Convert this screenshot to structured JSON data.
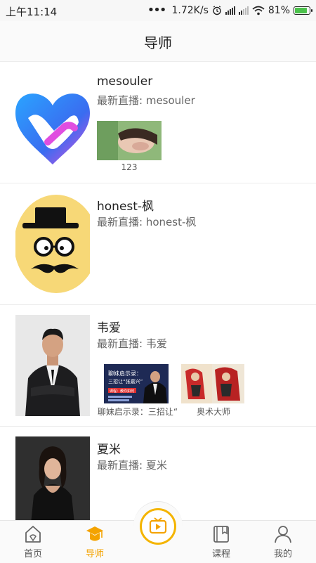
{
  "status_bar": {
    "time": "上午11:14",
    "network_speed": "1.72K/s",
    "battery": "81%"
  },
  "header": {
    "title": "导师"
  },
  "mentors": [
    {
      "name": "mesouler",
      "latest_label": "最新直播",
      "latest_value": "mesouler",
      "lives": [
        {
          "title": "123"
        }
      ]
    },
    {
      "name": "honest-枫",
      "latest_label": "最新直播",
      "latest_value": "honest-枫",
      "lives": []
    },
    {
      "name": "韦爱",
      "latest_label": "最新直播",
      "latest_value": "韦爱",
      "lives": [
        {
          "title": "聊妹启示录：三招让“"
        },
        {
          "title": "奥术大师"
        }
      ]
    },
    {
      "name": "夏米",
      "latest_label": "最新直播",
      "latest_value": "夏米",
      "lives": []
    }
  ],
  "thumbnail_text": {
    "poster_1_title": "聊妹启示录：",
    "poster_1_sub": "三招让“张嘉兴”",
    "poster_1_tag": "课程：教你如何"
  },
  "tabs": [
    {
      "label": "首页",
      "icon": "home-icon"
    },
    {
      "label": "导师",
      "icon": "graduation-cap-icon",
      "active": true
    },
    {
      "label": "",
      "icon": "live-tv-icon"
    },
    {
      "label": "课程",
      "icon": "book-icon"
    },
    {
      "label": "我的",
      "icon": "user-icon"
    }
  ],
  "colors": {
    "accent": "#f4a300",
    "header_bg": "#fafafa",
    "divider": "#ececec"
  }
}
